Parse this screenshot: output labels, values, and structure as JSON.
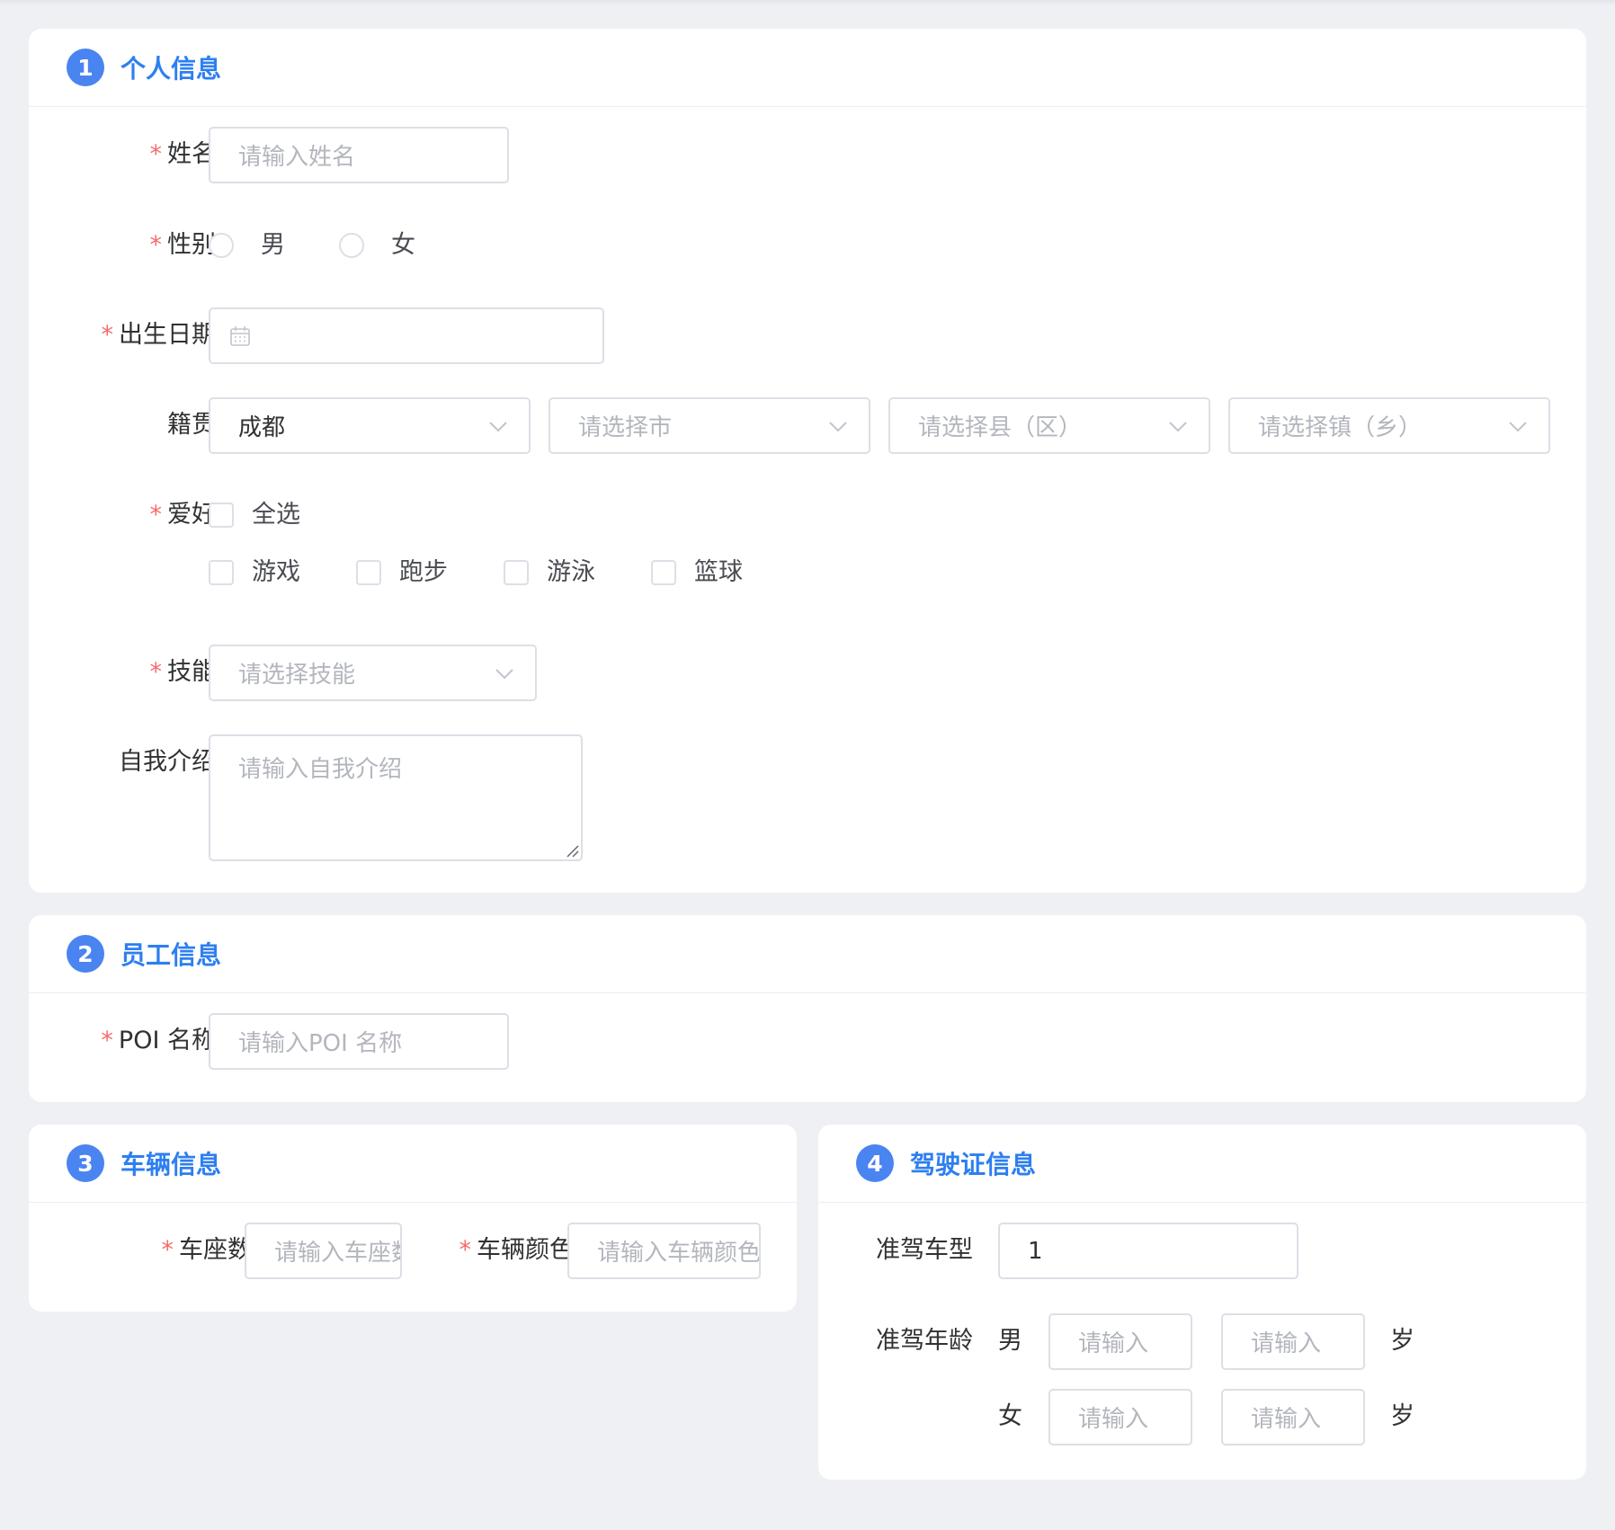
{
  "personal": {
    "step": "1",
    "title": "个人信息",
    "name": {
      "label": "姓名",
      "placeholder": "请输入姓名"
    },
    "gender": {
      "label": "性别",
      "options": [
        "男",
        "女"
      ]
    },
    "birth": {
      "label": "出生日期"
    },
    "native": {
      "label": "籍贯",
      "province_value": "成都",
      "city_placeholder": "请选择市",
      "county_placeholder": "请选择县（区）",
      "town_placeholder": "请选择镇（乡）"
    },
    "hobby": {
      "label": "爱好",
      "all": "全选",
      "options": [
        "游戏",
        "跑步",
        "游泳",
        "篮球"
      ]
    },
    "skill": {
      "label": "技能",
      "placeholder": "请选择技能"
    },
    "intro": {
      "label": "自我介绍",
      "placeholder": "请输入自我介绍"
    }
  },
  "employee": {
    "step": "2",
    "title": "员工信息",
    "poi": {
      "label": "POI 名称",
      "placeholder": "请输入POI 名称"
    }
  },
  "vehicle": {
    "step": "3",
    "title": "车辆信息",
    "seats": {
      "label": "车座数",
      "placeholder": "请输入车座数"
    },
    "color": {
      "label": "车辆颜色",
      "placeholder": "请输入车辆颜色"
    }
  },
  "license": {
    "step": "4",
    "title": "驾驶证信息",
    "type": {
      "label": "准驾车型",
      "value": "1"
    },
    "age": {
      "label": "准驾年龄",
      "male": "男",
      "female": "女",
      "placeholder": "请输入",
      "unit": "岁"
    }
  },
  "colors": {
    "accent": "#2d7ff0",
    "badge": "#4a84f1",
    "required": "#f56c6c",
    "background": "#eff0f4"
  }
}
